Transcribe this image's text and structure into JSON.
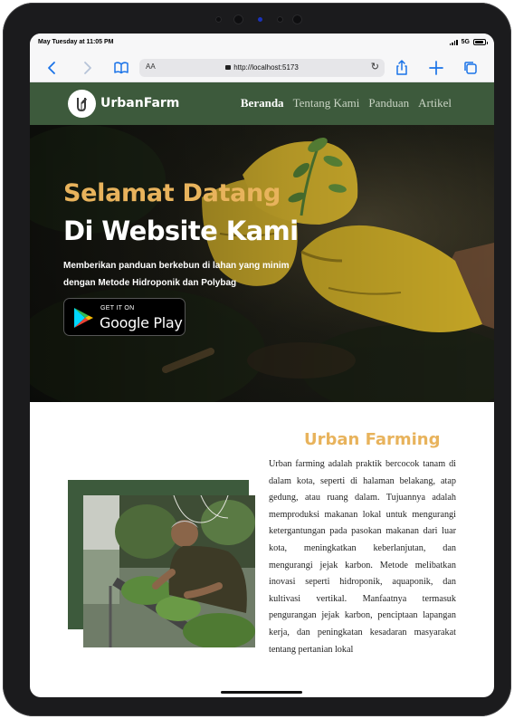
{
  "status_bar": {
    "time": "May Tuesday at 11:05 PM",
    "network": "5G",
    "battery_level": 0.9
  },
  "browser": {
    "text_size_label": "AA",
    "url": "http://localhost:5173",
    "icons": [
      "back-icon",
      "forward-icon",
      "bookmarks-icon",
      "lock-icon",
      "reload-icon",
      "share-icon",
      "new-tab-icon",
      "tabs-icon"
    ]
  },
  "site": {
    "brand": "UrbanFarm",
    "nav": [
      "Beranda",
      "Tentang Kami",
      "Panduan",
      "Artikel"
    ],
    "active_nav": "Beranda",
    "colors": {
      "primary": "#3d5a3c",
      "accent": "#e8b35c"
    }
  },
  "hero": {
    "title_line1": "Selamat Datang",
    "title_line2": "Di Website Kami",
    "subtitle": "Memberikan panduan berkebun di lahan yang minim dengan Metode Hidroponik dan Polybag",
    "store_badge": {
      "small": "GET IT ON",
      "large": "Google Play"
    }
  },
  "about": {
    "title": "Urban Farming",
    "text": "Urban farming adalah praktik bercocok tanam di dalam kota, seperti di halaman belakang, atap gedung, atau ruang dalam. Tujuannya adalah memproduksi makanan lokal untuk mengurangi ketergantungan pada pasokan makanan dari luar kota, meningkatkan keberlanjutan, dan mengurangi jejak karbon. Metode melibatkan inovasi seperti hidroponik, aquaponik, dan kultivasi vertikal. Manfaatnya termasuk pengurangan jejak karbon, penciptaan lapangan kerja, dan peningkatan kesadaran masyarakat tentang pertanian lokal"
  }
}
